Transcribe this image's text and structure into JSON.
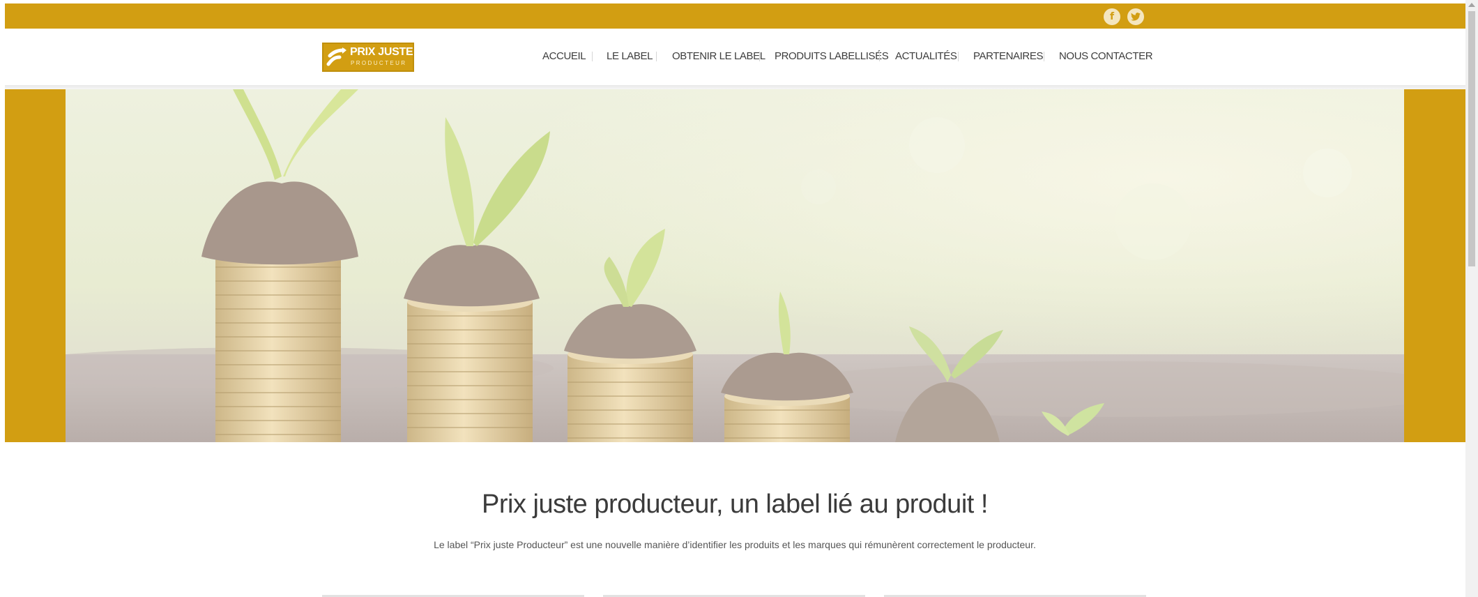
{
  "colors": {
    "brand_gold": "#d29e12",
    "nav_text": "#3d3d3d",
    "heading_text": "#3b3b3b",
    "body_text": "#555555"
  },
  "social": [
    {
      "name": "facebook",
      "icon": "facebook-icon",
      "glyph": "f"
    },
    {
      "name": "twitter",
      "icon": "twitter-icon",
      "glyph": "t"
    }
  ],
  "logo": {
    "main": "PRIX JUSTE",
    "sub": "PRODUCTEUR"
  },
  "nav": {
    "items": [
      "ACCUEIL",
      "LE LABEL",
      "OBTENIR LE LABEL",
      "PRODUITS LABELLISÉS",
      "ACTUALITÉS",
      "PARTENAIRES",
      "NOUS CONTACTER"
    ]
  },
  "hero": {
    "image": "coins-with-plant-sprouts"
  },
  "intro": {
    "title": "Prix juste producteur, un label lié au produit !",
    "text": "Le label “Prix juste Producteur” est une nouvelle manière d’identifier les produits et les marques qui rémunèrent correctement le producteur."
  }
}
